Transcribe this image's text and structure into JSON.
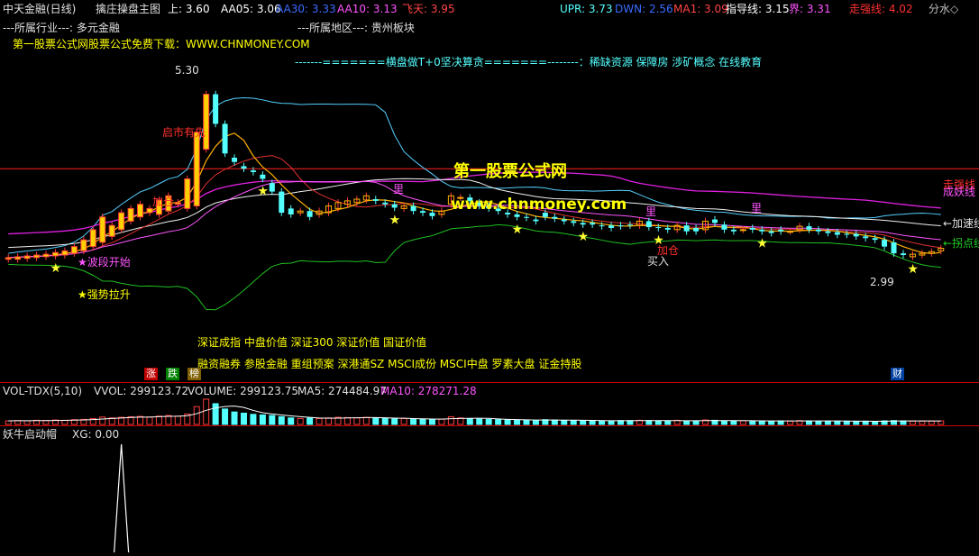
{
  "colors": {
    "bg": "#000000",
    "up": "#ff3b3b",
    "down": "#54ffff",
    "yellow": "#ffff00",
    "white": "#ffffff",
    "magenta": "#ff00ff",
    "green": "#20c020",
    "red": "#ff2020",
    "label": "#e0e0e0",
    "star": "#ffff33",
    "cyan": "#00c0ff"
  },
  "header": {
    "stock": "中天金融(日线)",
    "indicator": "擒庄操盘主图",
    "shang": "上: 3.60",
    "aa05": "AA05: 3.06",
    "aa30": "AA30: 3.33",
    "aa10": "AA10: 3.13",
    "feitian": "飞天: 3.95",
    "upr": "UPR: 3.73",
    "dwn": "DWN: 2.56",
    "ma1": "MA1: 3.09",
    "zhidao": "指导线: 3.15",
    "jie": "界: 3.31",
    "zouqiang": "走强线: 4.02",
    "fenshui": "分水◇"
  },
  "info": {
    "industry": "---所属行业---:  多元金融",
    "region": "---所属地区---:  贵州板块",
    "download": "第一股票公式网股票公式免费下载：WWW.CHNMONEY.COM",
    "concept": "-------=======横盘做T+0坚决算贪=======--------：稀缺资源 保障房 涉矿概念 在线教育"
  },
  "watermark": {
    "title": "第一股票公式网",
    "url": "www.chnmoney.com"
  },
  "annotations": {
    "high_price": "5.30",
    "low_price": "2.99",
    "shichang": "启市有先",
    "jiacang1": "加仓",
    "jiacang2": "加仓",
    "mairu": "买入",
    "bodong": "★波段开始",
    "qiangshi": "★强势拉升",
    "li1": "里",
    "li2": "里",
    "li3": "里",
    "right1": "走强线",
    "right2": "成妖线",
    "right3": "←加速线",
    "right4": "←拐点线"
  },
  "blocks": {
    "line1": "深证成指 中盘价值 深证300 深证价值 国证价值",
    "line2": "融资融券 参股金融 重组预案 深港通SZ MSCI成份 MSCI中盘 罗素大盘 证金持股"
  },
  "badges": {
    "zhang": "涨",
    "die": "跌",
    "bang": "榜",
    "cai": "财"
  },
  "vol": {
    "name": "VOL-TDX(5,10)",
    "vvol": "VVOL: 299123.72",
    "volume": "VOLUME: 299123.75",
    "ma5": "MA5: 274484.97",
    "ma10": "MA10: 278271.28"
  },
  "xg": {
    "name": "妖牛启动帽",
    "value": "XG: 0.00"
  },
  "chart_data": {
    "type": "candlestick",
    "ylim": [
      2.5,
      5.8
    ],
    "open": [
      2.95,
      2.95,
      2.96,
      2.97,
      2.98,
      2.99,
      3.0,
      3.02,
      3.05,
      3.1,
      3.15,
      3.22,
      3.3,
      3.4,
      3.45,
      3.5,
      3.48,
      3.52,
      3.6,
      3.55,
      3.58,
      4.25,
      4.9,
      4.55,
      4.15,
      4.05,
      4.0,
      3.95,
      3.85,
      3.75,
      3.55,
      3.5,
      3.52,
      3.48,
      3.5,
      3.55,
      3.6,
      3.62,
      3.65,
      3.66,
      3.62,
      3.6,
      3.55,
      3.58,
      3.52,
      3.5,
      3.48,
      3.6,
      3.68,
      3.68,
      3.62,
      3.58,
      3.55,
      3.5,
      3.48,
      3.45,
      3.42,
      3.5,
      3.45,
      3.42,
      3.4,
      3.38,
      3.38,
      3.35,
      3.35,
      3.35,
      3.36,
      3.35,
      3.4,
      3.33,
      3.32,
      3.3,
      3.35,
      3.32,
      3.3,
      3.42,
      3.36,
      3.3,
      3.3,
      3.32,
      3.3,
      3.28,
      3.3,
      3.28,
      3.3,
      3.34,
      3.3,
      3.28,
      3.27,
      3.25,
      3.25,
      3.22,
      3.2,
      3.18,
      3.15,
      3.02,
      2.98,
      3.0,
      3.02,
      3.05
    ],
    "close": [
      2.97,
      2.98,
      2.99,
      3.0,
      3.01,
      3.03,
      3.05,
      3.1,
      3.18,
      3.3,
      3.45,
      3.35,
      3.5,
      3.55,
      3.6,
      3.55,
      3.65,
      3.7,
      3.62,
      3.9,
      4.45,
      4.9,
      4.55,
      4.2,
      4.1,
      4.02,
      3.98,
      3.9,
      3.75,
      3.5,
      3.48,
      3.52,
      3.45,
      3.52,
      3.58,
      3.62,
      3.64,
      3.66,
      3.7,
      3.64,
      3.6,
      3.56,
      3.58,
      3.52,
      3.5,
      3.46,
      3.52,
      3.7,
      3.68,
      3.64,
      3.58,
      3.55,
      3.52,
      3.48,
      3.45,
      3.44,
      3.4,
      3.45,
      3.43,
      3.4,
      3.38,
      3.36,
      3.36,
      3.34,
      3.32,
      3.34,
      3.35,
      3.4,
      3.33,
      3.32,
      3.3,
      3.35,
      3.28,
      3.28,
      3.4,
      3.38,
      3.3,
      3.28,
      3.3,
      3.3,
      3.28,
      3.26,
      3.28,
      3.28,
      3.34,
      3.3,
      3.28,
      3.26,
      3.24,
      3.24,
      3.22,
      3.2,
      3.18,
      3.1,
      3.02,
      3.0,
      3.01,
      3.02,
      3.04,
      3.08
    ],
    "volume": [
      12,
      13,
      12,
      14,
      13,
      15,
      14,
      16,
      17,
      20,
      25,
      22,
      24,
      26,
      27,
      25,
      28,
      30,
      28,
      35,
      60,
      85,
      70,
      52,
      42,
      38,
      34,
      32,
      30,
      26,
      22,
      20,
      21,
      20,
      22,
      24,
      23,
      22,
      24,
      22,
      20,
      19,
      20,
      18,
      17,
      17,
      18,
      26,
      22,
      20,
      18,
      17,
      16,
      15,
      15,
      14,
      14,
      16,
      15,
      14,
      13,
      13,
      13,
      12,
      12,
      13,
      13,
      14,
      13,
      12,
      12,
      14,
      12,
      12,
      15,
      14,
      12,
      12,
      12,
      12,
      12,
      11,
      12,
      11,
      13,
      12,
      11,
      11,
      11,
      11,
      11,
      11,
      10,
      12,
      13,
      12,
      11,
      11,
      11,
      12
    ],
    "xg_signal_index": 12
  }
}
